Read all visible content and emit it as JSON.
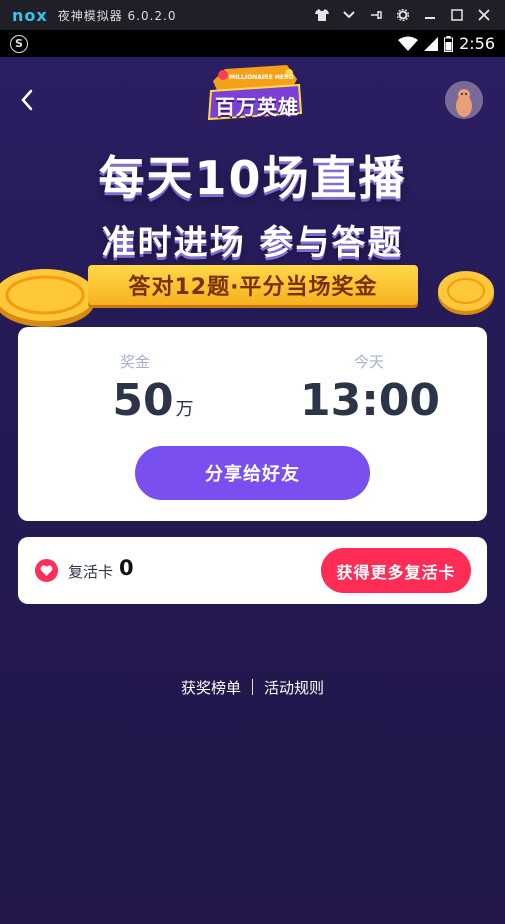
{
  "emulator": {
    "logo": "nox",
    "title": "夜神模拟器 6.0.2.0",
    "controls": [
      "shirt-icon",
      "chevron-down-icon",
      "pin-icon",
      "gear-icon",
      "minimize-icon",
      "maximize-icon",
      "close-icon"
    ]
  },
  "status_bar": {
    "app_icon": "S",
    "time": "2:56",
    "icons": [
      "wifi-icon",
      "signal-icon",
      "battery-icon"
    ]
  },
  "header": {
    "logo_text": "百万英雄",
    "logo_subtitle": "MILLIONAIRE HERO"
  },
  "hero": {
    "line1": "每天10场直播",
    "line2": "准时进场 参与答题",
    "ribbon": "答对12题·平分当场奖金"
  },
  "prize_card": {
    "prize_label": "奖金",
    "prize_value": "50",
    "prize_unit": "万",
    "time_label": "今天",
    "time_value": "13:00",
    "share_button": "分享给好友"
  },
  "revive_card": {
    "label": "复活卡",
    "count": "0",
    "more_button": "获得更多复活卡"
  },
  "footer": {
    "winners_link": "获奖榜单",
    "rules_link": "活动规则"
  },
  "colors": {
    "background": "#231a4b",
    "share_button": "#7a4ff0",
    "more_button": "#ff2d55",
    "card": "#ffffff"
  }
}
